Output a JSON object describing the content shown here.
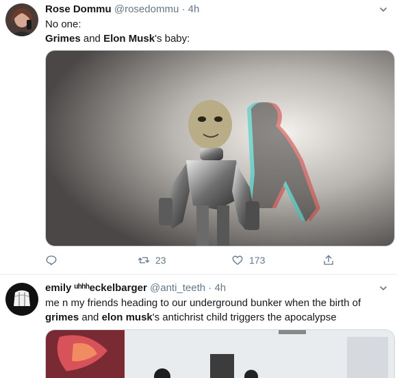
{
  "tweets": [
    {
      "name": "Rose Dommu",
      "handle": "@rosedommu",
      "separator": "·",
      "time": "4h",
      "line1": "No one:",
      "line2_a": "Grimes",
      "line2_b": " and ",
      "line2_c": "Elon Musk",
      "line2_d": "'s baby:",
      "actions": {
        "retweets": "23",
        "likes": "173"
      }
    },
    {
      "name": "emily ᵘʰʰʰeckelbarger",
      "handle": "@anti_teeth",
      "separator": "·",
      "time": "4h",
      "line1": "me n my friends heading to our underground bunker when the birth of",
      "line2_a": "grimes",
      "line2_b": " and ",
      "line2_c": "elon musk",
      "line2_d": "'s antichrist child triggers the apocalypse"
    }
  ],
  "colors": {
    "secondary": "#657786",
    "text": "#14171a",
    "border": "#e6ecf0"
  }
}
